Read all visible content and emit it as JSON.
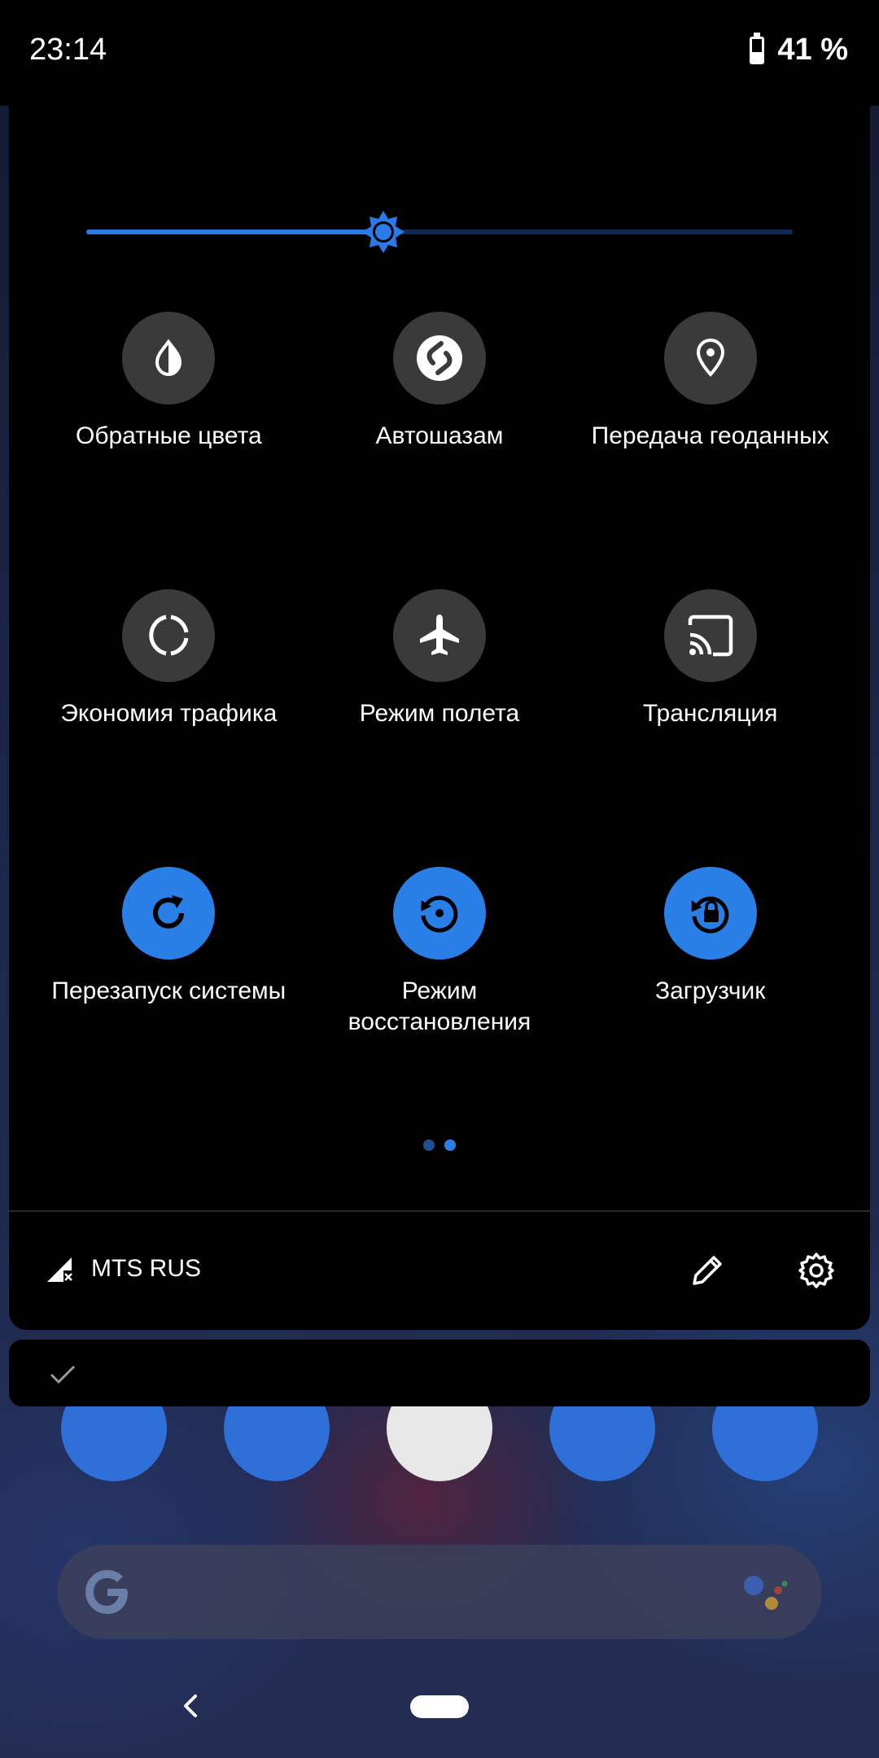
{
  "status_bar": {
    "time": "23:14",
    "battery_percent_text": "41 %",
    "battery_level": 0.41
  },
  "brightness": {
    "level": 0.42
  },
  "tiles": [
    {
      "label": "Обратные цвета",
      "icon": "invert-colors-icon",
      "active": false
    },
    {
      "label": "Автошазам",
      "icon": "shazam-icon",
      "active": false
    },
    {
      "label": "Передача геоданных",
      "icon": "location-pin-icon",
      "active": false
    },
    {
      "label": "Экономия трафика",
      "icon": "data-saver-icon",
      "active": false
    },
    {
      "label": "Режим полета",
      "icon": "airplane-icon",
      "active": false
    },
    {
      "label": "Трансляция",
      "icon": "cast-icon",
      "active": false
    },
    {
      "label": "Перезапуск системы",
      "icon": "restart-icon",
      "active": true
    },
    {
      "label": "Режим восстановления",
      "icon": "recovery-icon",
      "active": true
    },
    {
      "label": "Загрузчик",
      "icon": "bootloader-lock-icon",
      "active": true
    }
  ],
  "pagination": {
    "pages": 2,
    "current": 2
  },
  "footer": {
    "carrier": "MTS RUS",
    "carrier_icon": "signal-no-data-icon",
    "edit_icon": "pencil-icon",
    "settings_icon": "gear-icon"
  },
  "notification": {
    "icon": "check-icon"
  },
  "colors": {
    "accent": "#2a7fe6",
    "tile_inactive": "#3a3a3a",
    "panel_bg": "#000000"
  }
}
